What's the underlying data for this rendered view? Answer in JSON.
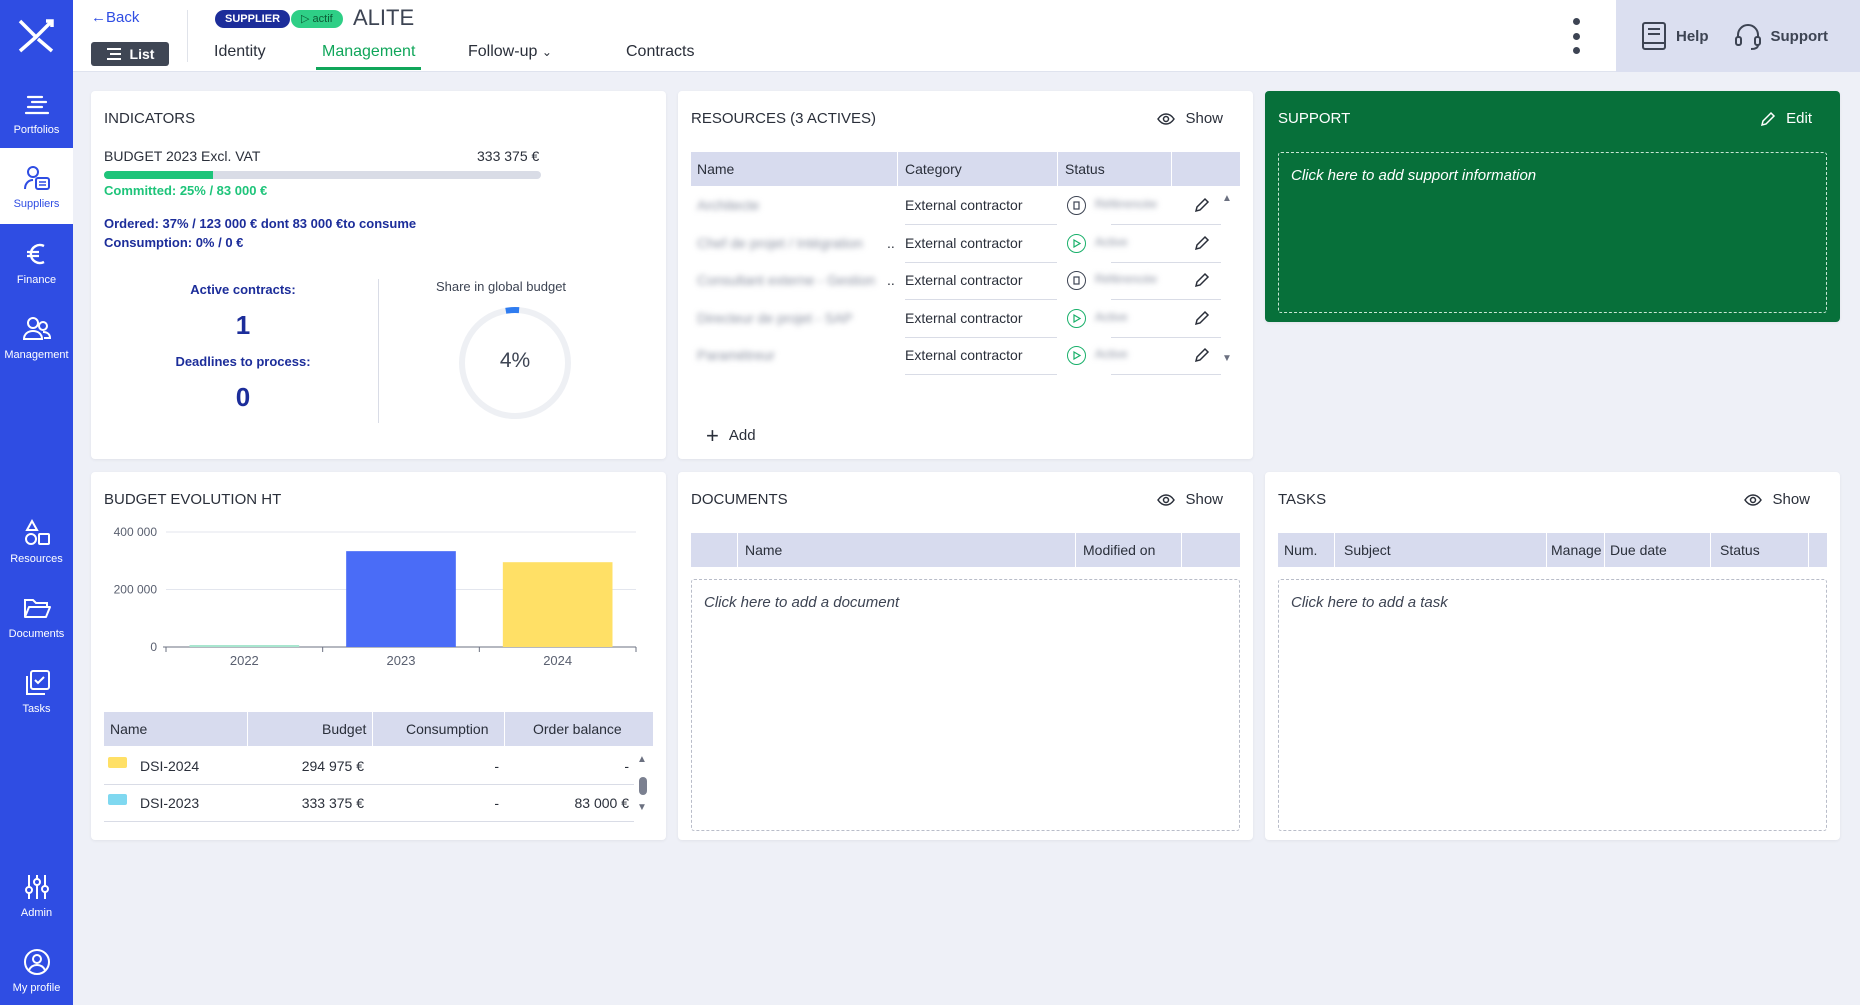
{
  "sidebar": {
    "items": [
      {
        "label": "Portfolios",
        "icon": "portfolios-icon"
      },
      {
        "label": "Suppliers",
        "icon": "suppliers-icon"
      },
      {
        "label": "Finance",
        "icon": "euro-icon"
      },
      {
        "label": "Management",
        "icon": "people-icon"
      },
      {
        "label": "Resources",
        "icon": "shapes-icon"
      },
      {
        "label": "Documents",
        "icon": "folder-icon"
      },
      {
        "label": "Tasks",
        "icon": "tasks-icon"
      },
      {
        "label": "Admin",
        "icon": "sliders-icon"
      },
      {
        "label": "My profile",
        "icon": "user-circle-icon"
      }
    ],
    "active": "Suppliers"
  },
  "header": {
    "back": "Back",
    "list_button": "List",
    "badge_supplier": "SUPPLIER",
    "badge_status": "actif",
    "supplier_name": "ALITE",
    "tabs": [
      "Identity",
      "Management",
      "Follow-up",
      "Contracts"
    ],
    "active_tab": "Management",
    "help": "Help",
    "support": "Support"
  },
  "indicators": {
    "title": "INDICATORS",
    "budget_label": "BUDGET 2023 Excl. VAT",
    "budget_value": "333 375 €",
    "committed_fraction": 0.25,
    "committed": "Committed: 25% / 83 000 €",
    "ordered": "Ordered: 37% / 123 000 € dont 83 000 €to consume",
    "consumption": "Consumption: 0% / 0 €",
    "active_contracts_label": "Active contracts:",
    "active_contracts": "1",
    "deadlines_label": "Deadlines to process:",
    "deadlines": "0",
    "share_label": "Share in global budget",
    "share_value": "4%",
    "share_fraction": 0.04
  },
  "resources": {
    "title": "RESOURCES (3 ACTIVES)",
    "show": "Show",
    "columns": [
      "Name",
      "Category",
      "Status"
    ],
    "rows": [
      {
        "name": "Architecte",
        "category": "External contractor",
        "status": "Référencée",
        "icon": "pause"
      },
      {
        "name": "Chef de projet / Intégration",
        "category": "External contractor",
        "status": "Active",
        "icon": "play"
      },
      {
        "name": "Consultant externe - Gestion",
        "category": "External contractor",
        "status": "Référencée",
        "icon": "pause"
      },
      {
        "name": "Directeur de projet - SAP",
        "category": "External contractor",
        "status": "Active",
        "icon": "play"
      },
      {
        "name": "Paramétreur",
        "category": "External contractor",
        "status": "Active",
        "icon": "play"
      }
    ],
    "add": "Add"
  },
  "support": {
    "title": "SUPPORT",
    "edit": "Edit",
    "placeholder": "Click here to add support information"
  },
  "budget_evolution": {
    "title": "BUDGET EVOLUTION HT",
    "table_columns": [
      "Name",
      "Budget",
      "Consumption",
      "Order balance"
    ],
    "table_rows": [
      {
        "name": "DSI-2024",
        "budget": "294 975 €",
        "consumption": "-",
        "order_balance": "-",
        "color": "#ffe066"
      },
      {
        "name": "DSI-2023",
        "budget": "333 375 €",
        "consumption": "-",
        "order_balance": "83 000 €",
        "color": "#7fd8f0"
      }
    ]
  },
  "chart_data": {
    "type": "bar",
    "categories": [
      "2022",
      "2023",
      "2024"
    ],
    "values": [
      0,
      333375,
      294975
    ],
    "colors": [
      "#a8e6cf",
      "#4a6cf7",
      "#ffe066"
    ],
    "yticks": [
      "0",
      "200 000",
      "400 000"
    ],
    "ylim": [
      0,
      400000
    ]
  },
  "documents": {
    "title": "DOCUMENTS",
    "show": "Show",
    "columns": [
      "Name",
      "Modified on"
    ],
    "placeholder": "Click here to add a document"
  },
  "tasks": {
    "title": "TASKS",
    "show": "Show",
    "columns": [
      "Num.",
      "Subject",
      "Manage",
      "Due date",
      "Status"
    ],
    "placeholder": "Click here to add a task"
  }
}
